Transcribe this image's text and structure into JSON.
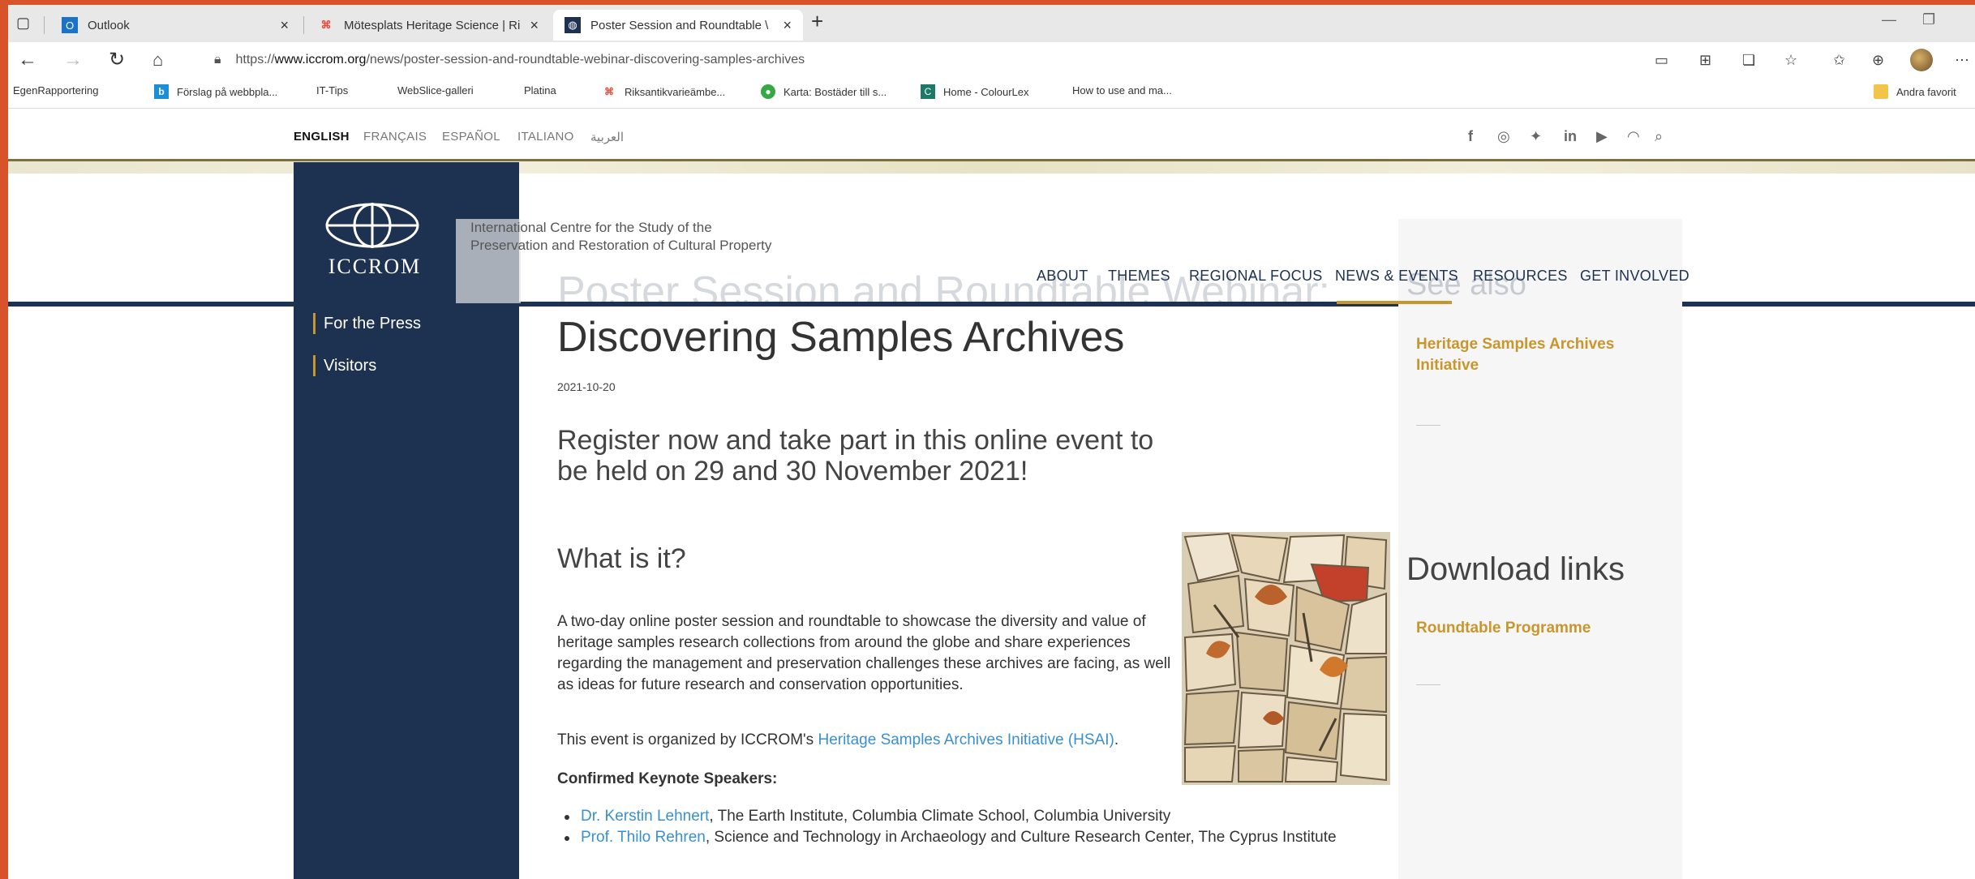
{
  "browser": {
    "tabs": [
      {
        "title": "Outlook",
        "icon": "outlook-icon",
        "active": false
      },
      {
        "title": "Mötesplats Heritage Science | Ri",
        "icon": "heritage-icon",
        "active": false
      },
      {
        "title": "Poster Session and Roundtable \\",
        "icon": "iccrom-icon",
        "active": true
      }
    ],
    "url_prefix": "https://",
    "url_host": "www.iccrom.org",
    "url_path": "/news/poster-session-and-roundtable-webinar-discovering-samples-archives",
    "bookmarks": [
      {
        "label": "EgenRapportering",
        "icon": "page-icon"
      },
      {
        "label": "Förslag på webbpla...",
        "icon": "bing-icon"
      },
      {
        "label": "IT-Tips",
        "icon": "page-icon"
      },
      {
        "label": "WebSlice-galleri",
        "icon": "page-icon"
      },
      {
        "label": "Platina",
        "icon": "page-icon"
      },
      {
        "label": "Riksantikvarieämbe...",
        "icon": "heritage-icon"
      },
      {
        "label": "Karta: Bostäder till s...",
        "icon": "karta-icon"
      },
      {
        "label": "Home - ColourLex",
        "icon": "colourlex-icon"
      },
      {
        "label": "How to use and ma...",
        "icon": "page-icon"
      }
    ],
    "other_favorites": "Andra favorit"
  },
  "site": {
    "languages": [
      "ENGLISH",
      "FRANÇAIS",
      "ESPAÑOL",
      "ITALIANO",
      "العربية"
    ],
    "logo_text": "ICCROM",
    "centre_name_line1": "International Centre for the Study of the",
    "centre_name_line2": "Preservation and Restoration of Cultural Property",
    "main_nav": [
      "ABOUT",
      "THEMES",
      "REGIONAL FOCUS",
      "NEWS & EVENTS",
      "RESOURCES",
      "GET INVOLVED"
    ],
    "sidebar_links": [
      "For the Press",
      "Visitors"
    ],
    "accent_gold": "#c8962d",
    "navy": "#1d3150"
  },
  "article": {
    "ghost_title": "Poster Session and Roundtable Webinar:",
    "title": "Discovering Samples Archives",
    "date": "2021-10-20",
    "lead": "Register now and take part in this online event to be held on 29 and 30 November 2021!",
    "what_heading": "What is it?",
    "description": "A two-day online poster session and roundtable to showcase the diversity and value of heritage samples research collections from around the globe and share experiences regarding the management and preservation challenges these archives are facing, as well as ideas for future research and conservation opportunities.",
    "organized_prefix": "This event is organized by ICCROM's ",
    "organized_link": "Heritage Samples Archives Initiative (HSAI)",
    "organized_suffix": ".",
    "keynote_heading": "Confirmed Keynote Speakers:",
    "speakers": [
      {
        "name": "Dr. Kerstin Lehnert",
        "affiliation": ", The Earth Institute, Columbia Climate School, Columbia University"
      },
      {
        "name": "Prof. Thilo Rehren",
        "affiliation": ", Science and Technology in Archaeology and Culture Research Center, The Cyprus Institute"
      }
    ]
  },
  "right_column": {
    "see_also_ghost": "See also",
    "see_also_link": "Heritage Samples Archives Initiative",
    "download_heading": "Download links",
    "download_link": "Roundtable Programme"
  }
}
